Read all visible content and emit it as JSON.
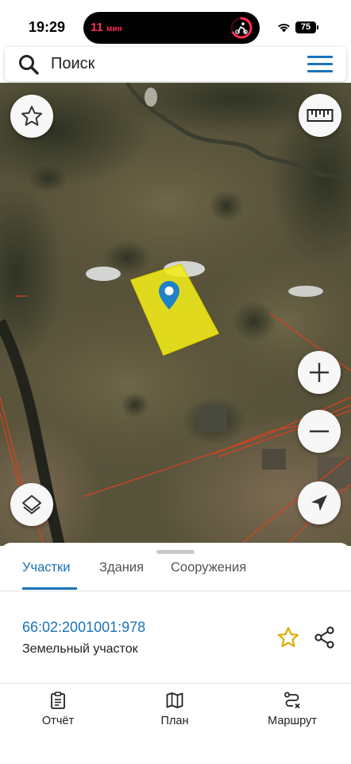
{
  "status_bar": {
    "time": "19:29",
    "island_timer": "11",
    "island_unit": "мин",
    "battery": "75"
  },
  "search": {
    "placeholder": "Поиск",
    "icon": "search-icon",
    "menu_icon": "hamburger-menu-icon"
  },
  "map": {
    "buttons": [
      {
        "name": "favorites-button",
        "icon": "star-outline-icon"
      },
      {
        "name": "ruler-button",
        "icon": "ruler-icon"
      },
      {
        "name": "zoom-in-button",
        "icon": "plus-icon"
      },
      {
        "name": "zoom-out-button",
        "icon": "minus-icon"
      },
      {
        "name": "layers-button",
        "icon": "layers-icon"
      },
      {
        "name": "my-location-button",
        "icon": "navigation-arrow-icon"
      }
    ],
    "colors": {
      "parcel_fill": "#f2ec1a",
      "parcel_border": "#e2d400",
      "boundary_lines": "#d9411f",
      "pin": "#1f82c6"
    }
  },
  "sheet": {
    "tabs": [
      {
        "label": "Участки",
        "active": true
      },
      {
        "label": "Здания",
        "active": false
      },
      {
        "label": "Сооружения",
        "active": false
      }
    ],
    "parcel": {
      "cadastral_number": "66:02:2001001:978",
      "type": "Земельный участок",
      "star_color": "#d9ae00"
    }
  },
  "bottom_nav": [
    {
      "label": "Отчёт",
      "icon": "report-clipboard-icon"
    },
    {
      "label": "План",
      "icon": "map-plan-icon"
    },
    {
      "label": "Маршрут",
      "icon": "route-icon"
    }
  ],
  "accent_color": "#1a73b8"
}
